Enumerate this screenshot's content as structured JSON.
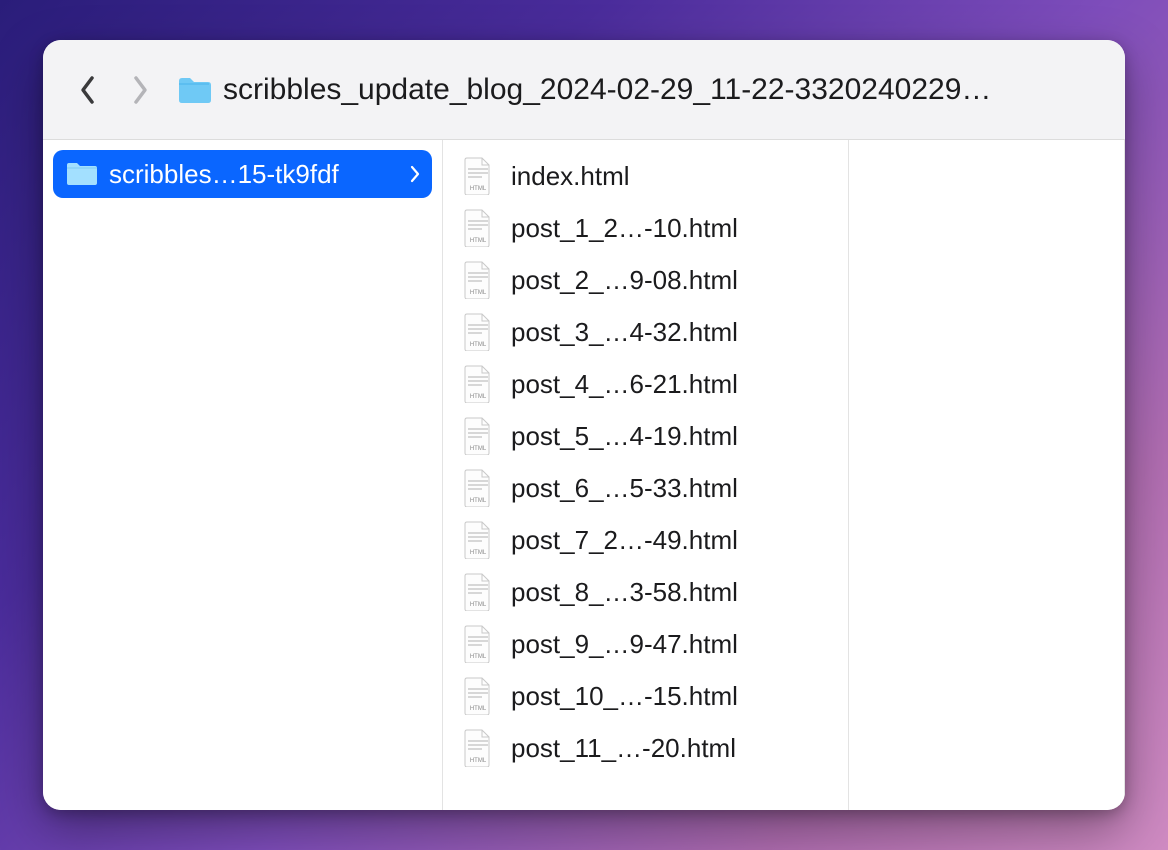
{
  "toolbar": {
    "title": "scribbles_update_blog_2024-02-29_11-22-3320240229…"
  },
  "column1": {
    "selected_folder": "scribbles…15-tk9fdf"
  },
  "column2": {
    "files": [
      "index.html",
      "post_1_2…-10.html",
      "post_2_…9-08.html",
      "post_3_…4-32.html",
      "post_4_…6-21.html",
      "post_5_…4-19.html",
      "post_6_…5-33.html",
      "post_7_2…-49.html",
      "post_8_…3-58.html",
      "post_9_…9-47.html",
      "post_10_…-15.html",
      "post_11_…-20.html"
    ]
  }
}
